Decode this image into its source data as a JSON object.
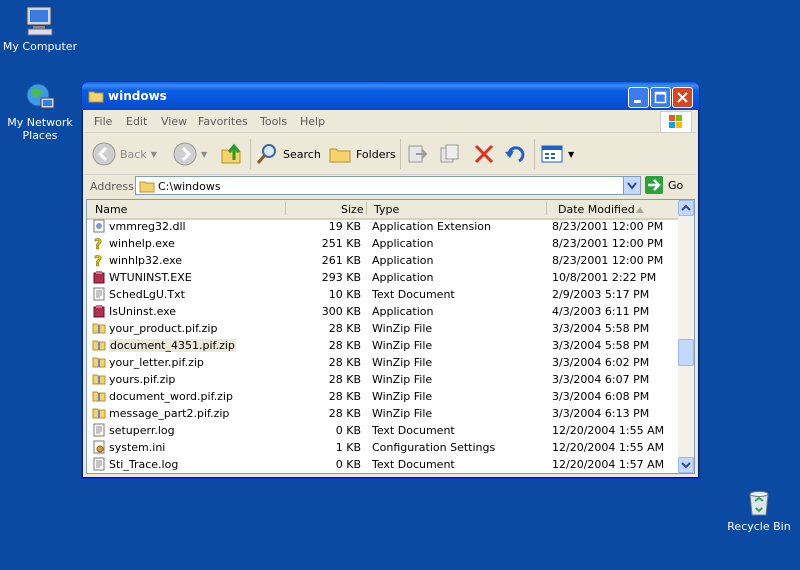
{
  "desktop": {
    "icons": [
      {
        "label": "My Computer"
      },
      {
        "label": "My Network Places"
      },
      {
        "label": "Recycle Bin"
      }
    ]
  },
  "window": {
    "title": "windows",
    "menu": [
      "File",
      "Edit",
      "View",
      "Favorites",
      "Tools",
      "Help"
    ],
    "toolbar": {
      "back_label": "Back",
      "search_label": "Search",
      "folders_label": "Folders"
    },
    "address": {
      "label": "Address",
      "value": "C:\\windows",
      "go_label": "Go"
    },
    "columns": {
      "name": "Name",
      "size": "Size",
      "type": "Type",
      "date": "Date Modified"
    },
    "files": [
      {
        "name": "vmmreg32.dll",
        "size": "19 KB",
        "type": "Application Extension",
        "date": "8/23/2001 12:00 PM",
        "icon": "dll-icon"
      },
      {
        "name": "winhelp.exe",
        "size": "251 KB",
        "type": "Application",
        "date": "8/23/2001 12:00 PM",
        "icon": "help-exe-icon"
      },
      {
        "name": "winhlp32.exe",
        "size": "261 KB",
        "type": "Application",
        "date": "8/23/2001 12:00 PM",
        "icon": "help-exe-icon"
      },
      {
        "name": "WTUNINST.EXE",
        "size": "293 KB",
        "type": "Application",
        "date": "10/8/2001 2:22 PM",
        "icon": "uninstaller-icon"
      },
      {
        "name": "SchedLgU.Txt",
        "size": "10 KB",
        "type": "Text Document",
        "date": "2/9/2003 5:17 PM",
        "icon": "text-file-icon"
      },
      {
        "name": "IsUninst.exe",
        "size": "300 KB",
        "type": "Application",
        "date": "4/3/2003 6:11 PM",
        "icon": "uninstaller-icon"
      },
      {
        "name": "your_product.pif.zip",
        "size": "28 KB",
        "type": "WinZip File",
        "date": "3/3/2004 5:58 PM",
        "icon": "zip-folder-icon"
      },
      {
        "name": "document_4351.pif.zip",
        "size": "28 KB",
        "type": "WinZip File",
        "date": "3/3/2004 5:58 PM",
        "icon": "zip-folder-icon"
      },
      {
        "name": "your_letter.pif.zip",
        "size": "28 KB",
        "type": "WinZip File",
        "date": "3/3/2004 6:02 PM",
        "icon": "zip-folder-icon"
      },
      {
        "name": "yours.pif.zip",
        "size": "28 KB",
        "type": "WinZip File",
        "date": "3/3/2004 6:07 PM",
        "icon": "zip-folder-icon"
      },
      {
        "name": "document_word.pif.zip",
        "size": "28 KB",
        "type": "WinZip File",
        "date": "3/3/2004 6:08 PM",
        "icon": "zip-folder-icon"
      },
      {
        "name": "message_part2.pif.zip",
        "size": "28 KB",
        "type": "WinZip File",
        "date": "3/3/2004 6:13 PM",
        "icon": "zip-folder-icon"
      },
      {
        "name": "setuperr.log",
        "size": "0 KB",
        "type": "Text Document",
        "date": "12/20/2004 1:55 AM",
        "icon": "text-file-icon"
      },
      {
        "name": "system.ini",
        "size": "1 KB",
        "type": "Configuration Settings",
        "date": "12/20/2004 1:55 AM",
        "icon": "config-file-icon"
      },
      {
        "name": "Sti_Trace.log",
        "size": "0 KB",
        "type": "Text Document",
        "date": "12/20/2004 1:57 AM",
        "icon": "text-file-icon"
      }
    ]
  }
}
